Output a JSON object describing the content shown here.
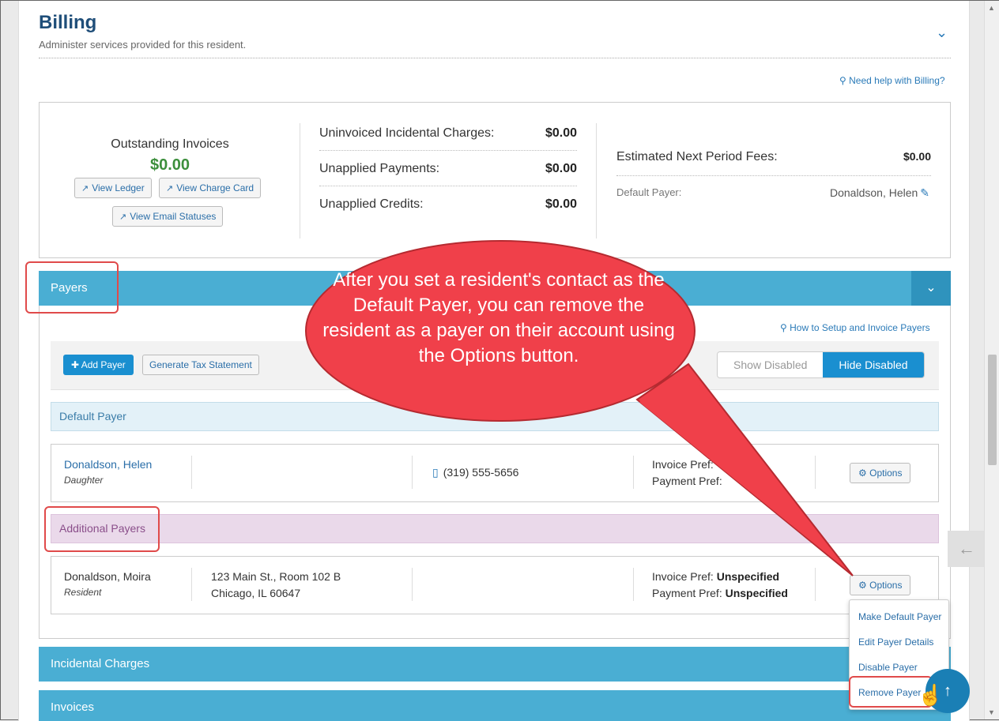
{
  "header": {
    "title": "Billing",
    "subtitle": "Administer services provided for this resident.",
    "help_link": "Need help with Billing?"
  },
  "summary": {
    "outstanding_label": "Outstanding Invoices",
    "outstanding_value": "$0.00",
    "view_ledger": "View Ledger",
    "view_charge_card": "View Charge Card",
    "view_email_statuses": "View Email Statuses",
    "rows": [
      {
        "label": "Uninvoiced Incidental Charges:",
        "value": "$0.00"
      },
      {
        "label": "Unapplied Payments:",
        "value": "$0.00"
      },
      {
        "label": "Unapplied Credits:",
        "value": "$0.00"
      }
    ],
    "estimated_label": "Estimated Next Period Fees:",
    "estimated_value": "$0.00",
    "default_payer_label": "Default Payer:",
    "default_payer_value": "Donaldson, Helen"
  },
  "payers": {
    "section_title": "Payers",
    "setup_link": "How to Setup and Invoice Payers",
    "add_payer": "Add Payer",
    "generate_tax": "Generate Tax Statement",
    "show_disabled": "Show Disabled",
    "hide_disabled": "Hide Disabled",
    "default_group": "Default Payer",
    "additional_group": "Additional Payers",
    "options_label": "Options",
    "default_payer": {
      "name": "Donaldson, Helen",
      "relation": "Daughter",
      "phone": "(319) 555-5656",
      "invoice_pref": "Invoice Pref:",
      "payment_pref": "Payment Pref:"
    },
    "additional_payer": {
      "name": "Donaldson, Moira",
      "relation": "Resident",
      "address_line1": "123 Main St., Room 102 B",
      "address_line2": "Chicago, IL 60647",
      "invoice_pref_label": "Invoice Pref:",
      "invoice_pref_value": "Unspecified",
      "payment_pref_label": "Payment Pref:",
      "payment_pref_value": "Unspecified"
    },
    "menu": [
      "Make Default Payer",
      "Edit Payer Details",
      "Disable Payer",
      "Remove Payer"
    ]
  },
  "sections": {
    "incidental": "Incidental Charges",
    "invoices": "Invoices"
  },
  "callout": {
    "text": "After you set a resident's contact as the Default Payer, you can remove the resident as a payer on their account using the Options button."
  },
  "colors": {
    "accent": "#4aaed3",
    "callout": "#f0404a",
    "highlight": "#e04a4a"
  }
}
